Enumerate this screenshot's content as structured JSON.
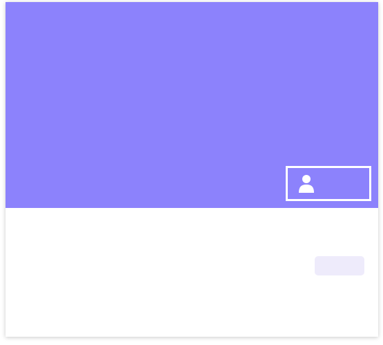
{
  "theme": {
    "accent": "#8c82fc",
    "surface": "#ffffff",
    "button_fill": "#eeebfb"
  },
  "hero": {
    "user_button": {
      "icon": "user-icon",
      "label": ""
    }
  },
  "content": {
    "action_button": {
      "label": ""
    }
  }
}
